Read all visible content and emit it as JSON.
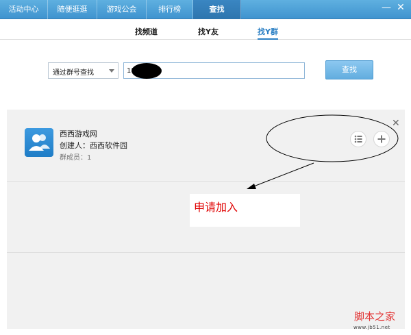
{
  "nav": {
    "tabs": [
      {
        "label": "活动中心"
      },
      {
        "label": "随便逛逛"
      },
      {
        "label": "游戏公会"
      },
      {
        "label": "排行榜"
      },
      {
        "label": "查找"
      }
    ],
    "active_index": 4,
    "minimize_label": "—",
    "close_label": "✕"
  },
  "subtabs": [
    {
      "label": "找频道"
    },
    {
      "label": "找Y友"
    },
    {
      "label": "找Y群"
    }
  ],
  "search": {
    "mode_selected": "通过群号查找",
    "input_value": "18",
    "button_label": "查找"
  },
  "result": {
    "name": "西西游戏网",
    "creator": "创建人：西西软件园",
    "members": "群成员：1",
    "close_label": "✕"
  },
  "annotation": {
    "text": "申请加入"
  },
  "watermark": {
    "main": "脚本之家",
    "sub": "www.jb51.net"
  },
  "colors": {
    "accent": "#3f93cf",
    "annotation_red": "#e00000"
  }
}
